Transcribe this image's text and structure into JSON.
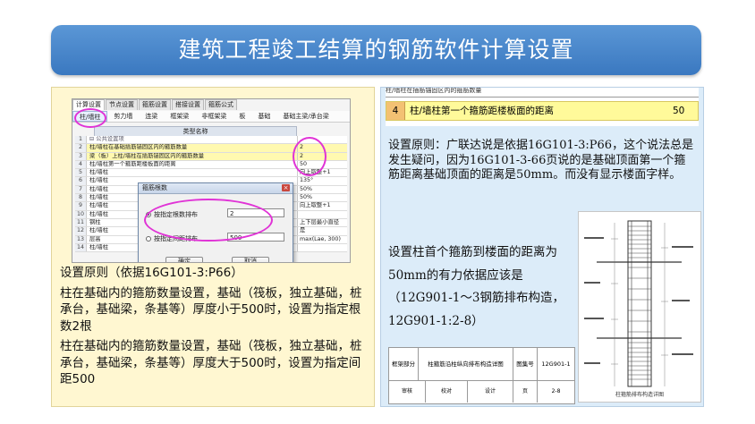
{
  "title": "建筑工程竣工结算的钢筋软件计算设置",
  "software": {
    "tabs": [
      "计算设置",
      "节点设置",
      "箍筋设置",
      "搭接设置",
      "箍筋公式"
    ],
    "component_tabs": [
      "柱/墙柱",
      "剪力墙",
      "连梁",
      "框架梁",
      "非框架梁",
      "板",
      "基础",
      "基础主梁/承台梁"
    ],
    "grid_header": "类型名称",
    "rows": [
      {
        "n": "1",
        "name": "⊟ 公共设置项",
        "value": ""
      },
      {
        "n": "2",
        "name": "柱/墙柱在基础插筋锚固区内的箍筋数量",
        "value": "2"
      },
      {
        "n": "3",
        "name": "梁（板）上柱/墙柱在插筋锚固区内的箍筋数量",
        "value": "2"
      },
      {
        "n": "4",
        "name": "柱/墙柱第一个箍筋距楼板面的距离",
        "value": "50"
      },
      {
        "n": "5",
        "name": "柱/墙柱",
        "value": "向上取整+1"
      },
      {
        "n": "6",
        "name": "柱/墙柱",
        "value": "135°"
      },
      {
        "n": "7",
        "name": "柱/墙柱",
        "value": "50%"
      },
      {
        "n": "8",
        "name": "柱/墙柱",
        "value": "50%"
      },
      {
        "n": "9",
        "name": "柱/墙柱",
        "value": "向上取整+1"
      },
      {
        "n": "10",
        "name": "柱/墙柱",
        "value": ""
      },
      {
        "n": "11",
        "name": "钢柱",
        "value": "上下层最小直径"
      },
      {
        "n": "12",
        "name": "柱/墙柱",
        "value": "是"
      },
      {
        "n": "13",
        "name": "层高",
        "value": "max(Lae, 300)"
      },
      {
        "n": "14",
        "name": "柱/墙柱",
        "value": ""
      }
    ],
    "dialog": {
      "title": "箍筋根数",
      "close": "×",
      "option1_label": "按指定根数排布",
      "option1_value": "2",
      "option2_label": "按指定间距排布",
      "option2_value": "500",
      "ok": "确定",
      "cancel": "取消"
    }
  },
  "left_text": {
    "p1": "设置原则（依据16G101-3:P66）",
    "p2": "柱在基础内的箍筋数量设置，基础（筏板，独立基础，桩承台，基础梁，条基等）厚度小于500时，设置为指定根数2根",
    "p3": "柱在基础内的箍筋数量设置，基础（筏板，独立基础，桩承台，基础梁，条基等）厚度大于500时，设置为指定间距500"
  },
  "right": {
    "table_top": "柱/墙柱在插筋锚固区内的箍筋数量",
    "row_num": "4",
    "row_text": "柱/墙柱第一个箍筋距楼板面的距离",
    "row_value": "50",
    "para1": "设置原则：广联达说是依据16G101-3:P66，这个说法总是发生疑问，因为16G101-3-66页说的是基础顶面第一个箍筋距离基础顶面的距离是50mm。而没有显示楼面字样。",
    "para2": "设置柱首个箍筋到楼面的距离为50mm的有力依据应该是（12G901-1～3钢筋排布构造，12G901-1:2-8）",
    "titleblock": {
      "c1": "框架部分",
      "c2": "柱箍筋沿柱纵向排布构造详图",
      "c3": "图集号",
      "c4": "12G901-1",
      "c5": "审核",
      "c6": "校对",
      "c7": "设计",
      "c8": "页",
      "c9": "2-8"
    },
    "drawing_caption": "柱箍筋排布构造详图"
  },
  "colors": {
    "title_bg": "#4a86cc",
    "left_bg": "#fff7d1",
    "right_bg": "#dcecf9",
    "highlight": "#e033d6"
  }
}
